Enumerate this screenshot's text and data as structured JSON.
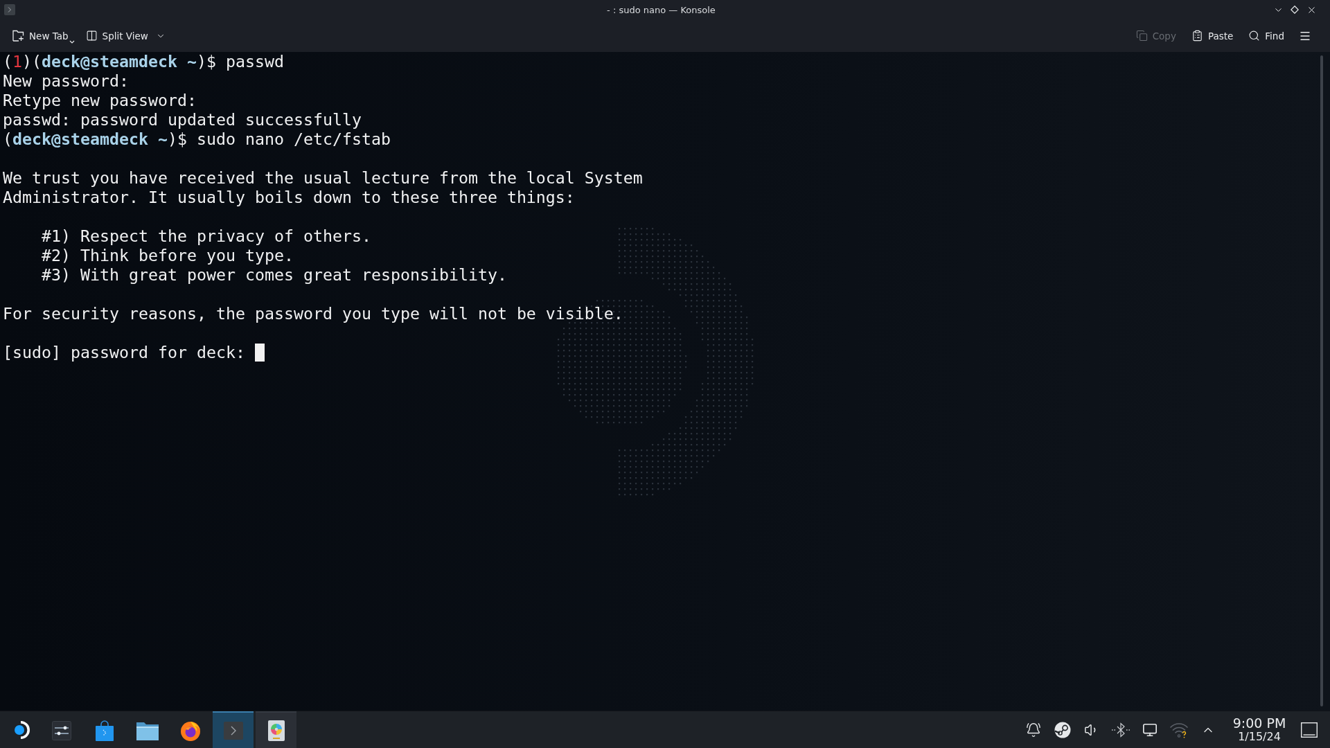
{
  "window": {
    "title": "- : sudo nano — Konsole"
  },
  "toolbar": {
    "left": [
      {
        "kind": "newtab",
        "label": "New Tab",
        "disabled": false
      },
      {
        "kind": "split",
        "label": "Split View",
        "disabled": false
      }
    ],
    "right": [
      {
        "kind": "copy",
        "label": "Copy",
        "disabled": true
      },
      {
        "kind": "paste",
        "label": "Paste",
        "disabled": false
      },
      {
        "kind": "find",
        "label": "Find",
        "disabled": false
      }
    ]
  },
  "terminal": {
    "blocks": [
      {
        "kind": "plain",
        "lines": [
          [
            {
              "kind": "plain",
              "text": "("
            },
            {
              "kind": "status",
              "text": "1"
            },
            {
              "kind": "plain",
              "text": ")("
            },
            {
              "kind": "host",
              "text": "deck@steamdeck ~"
            },
            {
              "kind": "plain",
              "text": ")$ passwd"
            }
          ],
          [
            {
              "kind": "plain",
              "text": "New password:"
            }
          ],
          [
            {
              "kind": "plain",
              "text": "Retype new password:"
            }
          ],
          [
            {
              "kind": "plain",
              "text": "passwd: password updated successfully"
            }
          ],
          [
            {
              "kind": "plain",
              "text": "("
            },
            {
              "kind": "host",
              "text": "deck@steamdeck ~"
            },
            {
              "kind": "plain",
              "text": ")$ sudo nano /etc/fstab"
            }
          ]
        ]
      },
      {
        "kind": "plain",
        "lines": [
          [
            {
              "kind": "plain",
              "text": "We trust you have received the usual lecture from the local System"
            }
          ],
          [
            {
              "kind": "plain",
              "text": "Administrator. It usually boils down to these three things:"
            }
          ]
        ]
      },
      {
        "kind": "indented",
        "lines": [
          [
            {
              "kind": "plain",
              "text": "#1) Respect the privacy of others."
            }
          ],
          [
            {
              "kind": "plain",
              "text": "#2) Think before you type."
            }
          ],
          [
            {
              "kind": "plain",
              "text": "#3) With great power comes great responsibility."
            }
          ]
        ]
      },
      {
        "kind": "plain",
        "lines": [
          [
            {
              "kind": "plain",
              "text": "For security reasons, the password you type will not be visible."
            }
          ]
        ]
      }
    ],
    "prompt": {
      "text": "[sudo] password for deck:",
      "cursor": true
    }
  },
  "taskbar": {
    "tasks": [
      {
        "kind": "settings",
        "selected": false,
        "open": false
      },
      {
        "kind": "store",
        "selected": false,
        "open": false
      },
      {
        "kind": "files",
        "selected": false,
        "open": false
      },
      {
        "kind": "browser",
        "selected": false,
        "open": false
      },
      {
        "kind": "terminal",
        "selected": true,
        "open": true
      },
      {
        "kind": "disk",
        "selected": false,
        "open": true
      }
    ],
    "clock": {
      "time": "9:00 PM",
      "date": "1/15/24"
    }
  }
}
